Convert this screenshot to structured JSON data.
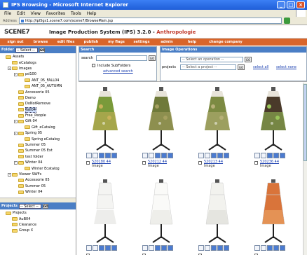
{
  "window": {
    "title": "IPS Browsing - Microsoft Internet Explorer"
  },
  "menu": [
    "File",
    "Edit",
    "View",
    "Favorites",
    "Tools",
    "Help"
  ],
  "address": {
    "label": "Address",
    "url": "http://ipl5gs1.scene7.com/scene7/BrowseMain.jsp"
  },
  "app": {
    "logo": "SCENE7",
    "title": "Image Production System (IPS) 3.2.0 -",
    "company": "Anthropologie"
  },
  "nav": [
    "sign out",
    "browse",
    "edit files",
    "publish",
    "my flags",
    "settings",
    "admin",
    "help",
    "change company"
  ],
  "folders": {
    "header": "Folder",
    "select": "-- Select --",
    "go": "GO",
    "items": [
      {
        "label": "Assets",
        "level": 0,
        "pm": ""
      },
      {
        "label": "eCatalogs",
        "level": 1,
        "pm": ""
      },
      {
        "label": "Images",
        "level": 1,
        "pm": "-"
      },
      {
        "label": "pd100",
        "level": 2,
        "pm": "-"
      },
      {
        "label": "ANT_05_FALL04",
        "level": 3,
        "pm": ""
      },
      {
        "label": "ANT_05_AUTUMN",
        "level": 3,
        "pm": ""
      },
      {
        "label": "Accessorie 05",
        "level": 2,
        "pm": ""
      },
      {
        "label": "Demo",
        "level": 2,
        "pm": ""
      },
      {
        "label": "DoNotRemove",
        "level": 2,
        "pm": ""
      },
      {
        "label": "fall04",
        "level": 2,
        "pm": "",
        "selected": true
      },
      {
        "label": "Free_People",
        "level": 2,
        "pm": ""
      },
      {
        "label": "Gift 04",
        "level": 2,
        "pm": "-"
      },
      {
        "label": "Gift_eCatalog",
        "level": 3,
        "pm": ""
      },
      {
        "label": "Spring 05",
        "level": 2,
        "pm": "-"
      },
      {
        "label": "Spring eCatalog",
        "level": 3,
        "pm": ""
      },
      {
        "label": "Summer 05",
        "level": 2,
        "pm": ""
      },
      {
        "label": "Summer 05 Ext",
        "level": 2,
        "pm": ""
      },
      {
        "label": "test folder",
        "level": 2,
        "pm": ""
      },
      {
        "label": "Winter 04",
        "level": 2,
        "pm": "-"
      },
      {
        "label": "Winter Ecatalog",
        "level": 3,
        "pm": ""
      },
      {
        "label": "Viewer SWFs",
        "level": 1,
        "pm": "-"
      },
      {
        "label": "Accessorie 05",
        "level": 2,
        "pm": ""
      },
      {
        "label": "Summer 05",
        "level": 2,
        "pm": ""
      },
      {
        "label": "Winter 04",
        "level": 2,
        "pm": ""
      }
    ]
  },
  "projects": {
    "header": "Projects",
    "select": "-- Select --",
    "go": "GO",
    "items": [
      {
        "label": "Projects",
        "level": 0
      },
      {
        "label": "AuB04",
        "level": 1
      },
      {
        "label": "Clearance",
        "level": 1
      },
      {
        "label": "Group X",
        "level": 1
      }
    ]
  },
  "search": {
    "header": "Search",
    "label": "search",
    "value": "",
    "go": "GO",
    "subfolders": "Include SubFolders",
    "advanced": "advanced search"
  },
  "operations": {
    "header": "Image Operations",
    "select": "-- Select an operation --",
    "projects_label": "projects",
    "projects_select": "-- Select a project --",
    "go": "GO",
    "select_all": "select all",
    "select_none": "select none"
  },
  "cards": [
    {
      "name": "520180 44",
      "type": "Image",
      "garment": "skirt",
      "primary": "#7a9a3a",
      "secondary": "#c9b15a"
    },
    {
      "name": "520212 44",
      "type": "Image",
      "garment": "skirt",
      "primary": "#6f7a3a",
      "secondary": "#a6a060"
    },
    {
      "name": "520213 44",
      "type": "Image",
      "garment": "skirt",
      "primary": "#7c8a42",
      "secondary": "#b7b078"
    },
    {
      "name": "520236 44",
      "type": "Image",
      "garment": "skirt",
      "primary": "#4a3a2a",
      "secondary": "#9ac55a"
    },
    {
      "name": "",
      "type": "",
      "garment": "top",
      "primary": "#f4f4f2",
      "secondary": "#dcdcd8"
    },
    {
      "name": "",
      "type": "",
      "garment": "dress",
      "primary": "#fafaf8",
      "secondary": "#e2e2dc"
    },
    {
      "name": "",
      "type": "",
      "garment": "dress",
      "primary": "#f2f2ee",
      "secondary": "#d8d8d2"
    },
    {
      "name": "",
      "type": "",
      "garment": "dress",
      "primary": "#d9743a",
      "secondary": "#f0b070"
    }
  ]
}
